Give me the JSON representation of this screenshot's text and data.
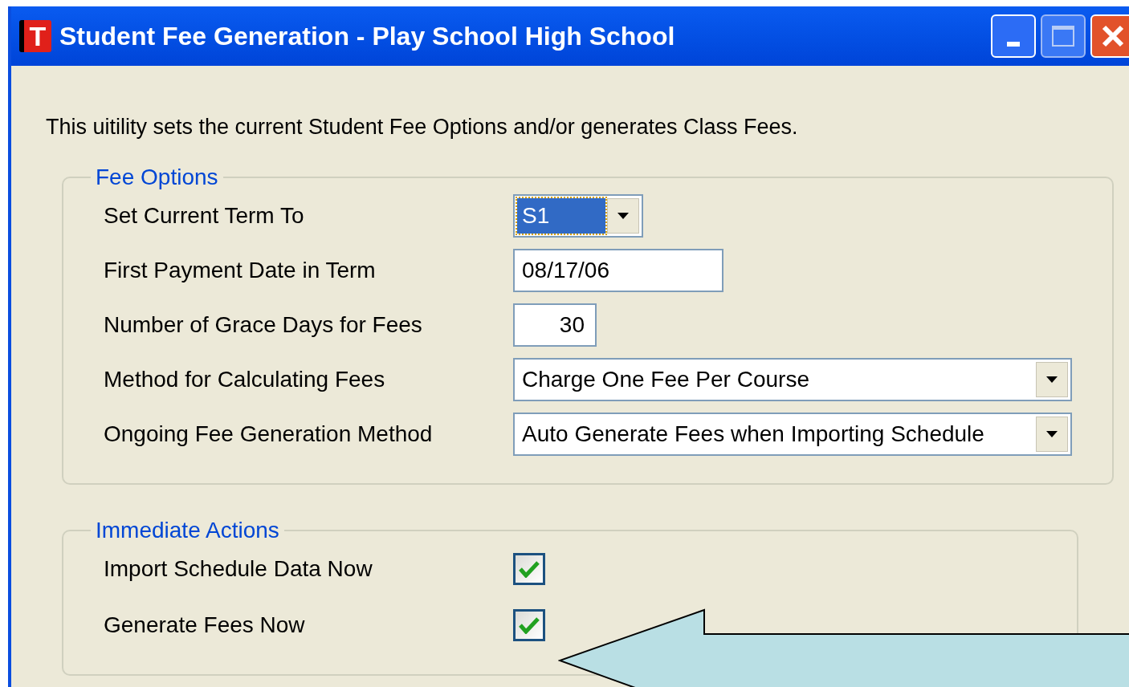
{
  "window": {
    "title": "Student Fee Generation - Play School High School",
    "app_icon_letter": "T"
  },
  "description": "This uitility sets the current Student Fee Options and/or generates Class Fees.",
  "fee_options": {
    "title": "Fee Options",
    "fields": [
      {
        "kind": "combo_small",
        "label": "Set Current Term To",
        "value": "S1",
        "focused": true
      },
      {
        "kind": "date",
        "label": "First Payment Date in Term",
        "value": "08/17/06",
        "focused": false
      },
      {
        "kind": "number",
        "label": "Number of Grace Days for Fees",
        "value": "30",
        "focused": false
      },
      {
        "kind": "combo",
        "label": "Method for Calculating Fees",
        "value": "Charge One Fee Per Course",
        "focused": false
      },
      {
        "kind": "combo",
        "label": "Ongoing Fee Generation Method",
        "value": "Auto Generate Fees when Importing Schedule",
        "focused": false
      }
    ]
  },
  "immediate_actions": {
    "title": "Immediate Actions",
    "items": [
      {
        "label": "Import Schedule Data Now",
        "checked": true
      },
      {
        "label": "Generate Fees Now",
        "checked": true
      }
    ]
  }
}
